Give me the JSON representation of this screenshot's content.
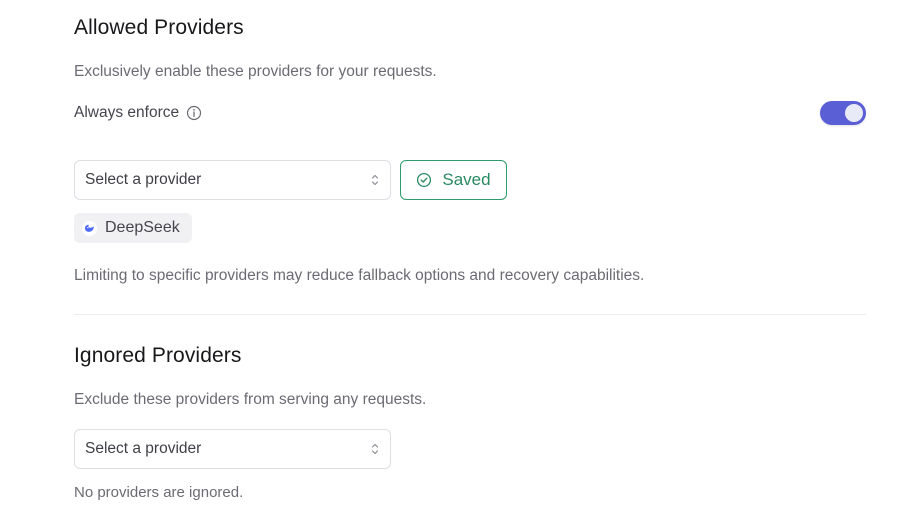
{
  "colors": {
    "accent": "#5b5fd6",
    "success": "#2e9d6e"
  },
  "allowed": {
    "title": "Allowed Providers",
    "description": "Exclusively enable these providers for your requests.",
    "enforce_label": "Always enforce",
    "enforce_on": true,
    "info_icon": "info-circle-icon",
    "select_placeholder": "Select a provider",
    "saved_label": "Saved",
    "saved_icon": "check-circle-icon",
    "chips": [
      {
        "label": "DeepSeek",
        "icon": "deepseek-logo-icon"
      }
    ],
    "warning": "Limiting to specific providers may reduce fallback options and recovery capabilities."
  },
  "ignored": {
    "title": "Ignored Providers",
    "description": "Exclude these providers from serving any requests.",
    "select_placeholder": "Select a provider",
    "empty_text": "No providers are ignored."
  }
}
